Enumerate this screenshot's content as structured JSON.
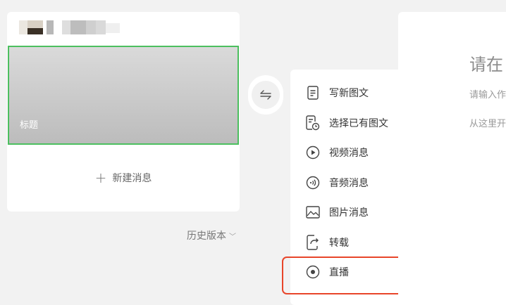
{
  "article": {
    "cover_title": "标题",
    "new_message_label": "新建消息",
    "history_label": "历史版本"
  },
  "menu": {
    "items": [
      {
        "label": "写新图文",
        "icon": "document-icon"
      },
      {
        "label": "选择已有图文",
        "icon": "document-clock-icon"
      },
      {
        "label": "视频消息",
        "icon": "play-circle-icon"
      },
      {
        "label": "音频消息",
        "icon": "audio-wave-icon"
      },
      {
        "label": "图片消息",
        "icon": "image-icon"
      },
      {
        "label": "转载",
        "icon": "share-icon"
      },
      {
        "label": "直播",
        "icon": "live-record-icon"
      }
    ]
  },
  "editor": {
    "title_placeholder": "请在",
    "author_placeholder": "请输入作",
    "body_placeholder": "从这里开"
  },
  "colors": {
    "selected_border": "#4cbf5f",
    "highlight_border": "#e8452a"
  }
}
